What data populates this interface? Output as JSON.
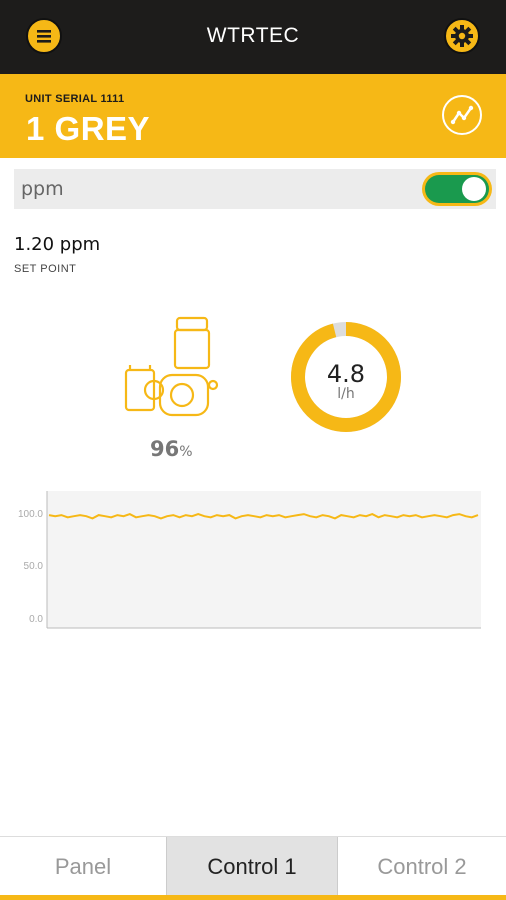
{
  "header": {
    "title": "WTRTEC",
    "menu_icon": "menu-icon",
    "settings_icon": "gear-icon"
  },
  "unit": {
    "serial": "UNIT SERIAL 1111",
    "name": "1 GREY",
    "trend_icon": "trend-icon"
  },
  "measure": {
    "label": "ppm",
    "toggle_on": true
  },
  "setpoint": {
    "value": "1.20 ppm",
    "label": "SET POINT"
  },
  "pump": {
    "percent": "96",
    "percent_unit": "%",
    "icon": "pump-icon"
  },
  "flow": {
    "value": "4.8",
    "unit": "l/h",
    "fraction": 0.96
  },
  "chart_data": {
    "type": "line",
    "ylim": [
      0,
      100
    ],
    "yticks": [
      "100.0",
      "50.0",
      "0.0"
    ],
    "grid": false,
    "series": [
      {
        "color": "#f6b816",
        "values": [
          98,
          97,
          98,
          96,
          97,
          98,
          97,
          95,
          98,
          97,
          96,
          98,
          97,
          99,
          96,
          97,
          98,
          97,
          95,
          97,
          98,
          96,
          98,
          97,
          99,
          97,
          96,
          98,
          97,
          98,
          95,
          97,
          98,
          97,
          96,
          98,
          97,
          98,
          96,
          97,
          98,
          99,
          97,
          96,
          98,
          97,
          95,
          98,
          97,
          96,
          98,
          97,
          99,
          96,
          98,
          97,
          96,
          98,
          97,
          98,
          96,
          97,
          98,
          97,
          96,
          98,
          99,
          97,
          96,
          98
        ]
      }
    ]
  },
  "tabs": [
    {
      "label": "Panel",
      "active": false
    },
    {
      "label": "Control 1",
      "active": true
    },
    {
      "label": "Control 2",
      "active": false
    }
  ],
  "colors": {
    "accent": "#f6b816",
    "dark": "#1d1c1b",
    "toggle": "#1a9a4e"
  }
}
